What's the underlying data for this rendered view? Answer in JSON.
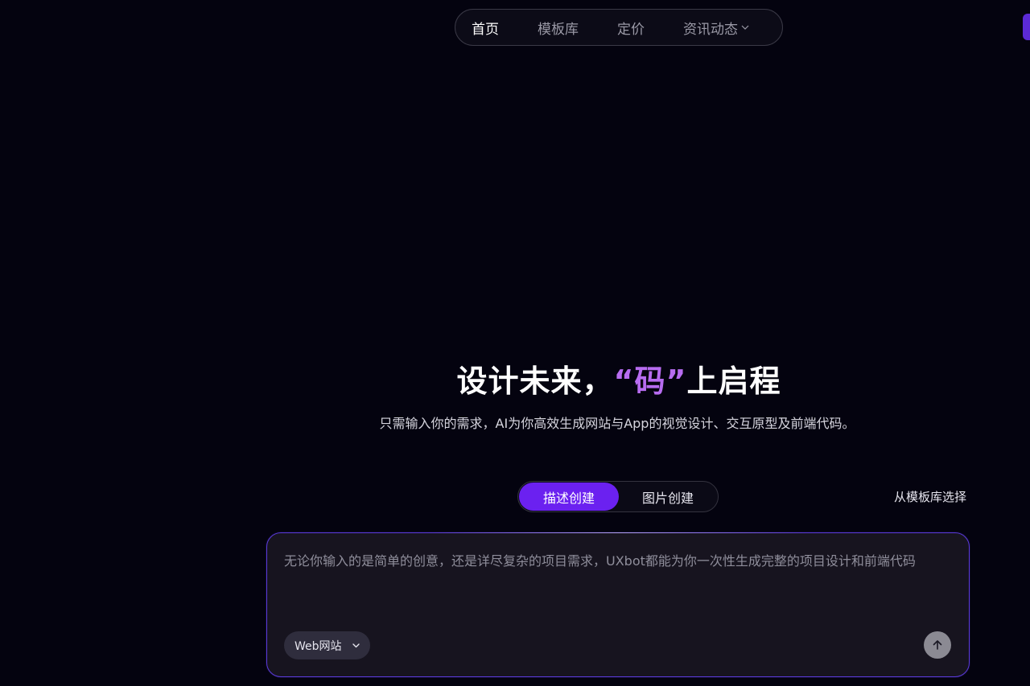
{
  "nav": {
    "items": [
      {
        "label": "首页",
        "active": true
      },
      {
        "label": "模板库",
        "active": false
      },
      {
        "label": "定价",
        "active": false
      },
      {
        "label": "资讯动态",
        "active": false,
        "has_dropdown": true
      }
    ]
  },
  "hero": {
    "title_before": "设计未来，",
    "title_accent": "“码”",
    "title_after": "上启程",
    "subtitle": "只需输入你的需求，AI为你高效生成网站与App的视觉设计、交互原型及前端代码。"
  },
  "mode_switch": {
    "options": [
      "描述创建",
      "图片创建"
    ],
    "selected": "描述创建"
  },
  "template_link": "从模板库选择",
  "prompt": {
    "placeholder": "无论你输入的是简单的创意，还是详尽复杂的项目需求，UXbot都能为你一次性生成完整的项目设计和前端代码",
    "value": ""
  },
  "type_select": {
    "value": "Web网站"
  },
  "icons": {
    "nav_dropdown": "chevron-down-icon",
    "type_dropdown": "chevron-down-icon",
    "send": "arrow-up-icon"
  },
  "colors": {
    "background": "#04030f",
    "accent": "#6b21f0",
    "title_accent": "#b76cf0",
    "prompt_border": "#5a3ad8"
  }
}
